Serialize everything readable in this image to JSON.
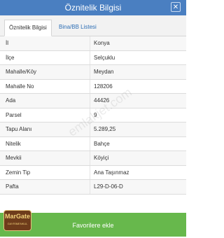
{
  "window": {
    "title": "Öznitelik Bilgisi",
    "close_icon": "close-icon"
  },
  "tabs": [
    {
      "label": "Öznitelik Bilgisi",
      "active": true
    },
    {
      "label": "Bina/BB Listesi",
      "active": false
    }
  ],
  "rows": [
    {
      "key": "İl",
      "value": "Konya"
    },
    {
      "key": "İlçe",
      "value": "Selçuklu"
    },
    {
      "key": "Mahalle/Köy",
      "value": "Meydan"
    },
    {
      "key": "Mahalle No",
      "value": "128206"
    },
    {
      "key": "Ada",
      "value": "44426"
    },
    {
      "key": "Parsel",
      "value": "9"
    },
    {
      "key": "Tapu Alanı",
      "value": "5.289,25"
    },
    {
      "key": "Nitelik",
      "value": "Bahçe"
    },
    {
      "key": "Mevkii",
      "value": "Köyiçi"
    },
    {
      "key": "Zemin Tip",
      "value": "Ana Taşınmaz"
    },
    {
      "key": "Pafta",
      "value": "L29-D-06-D"
    }
  ],
  "footer": {
    "button_label": "Favorilere ekle"
  },
  "watermark": "emlakjet.com",
  "logo": {
    "line1": "MarGate",
    "line2": "GAYRİMENKUL"
  },
  "colors": {
    "header": "#4a7fc1",
    "button": "#67b84c",
    "link": "#2e6fb5"
  }
}
